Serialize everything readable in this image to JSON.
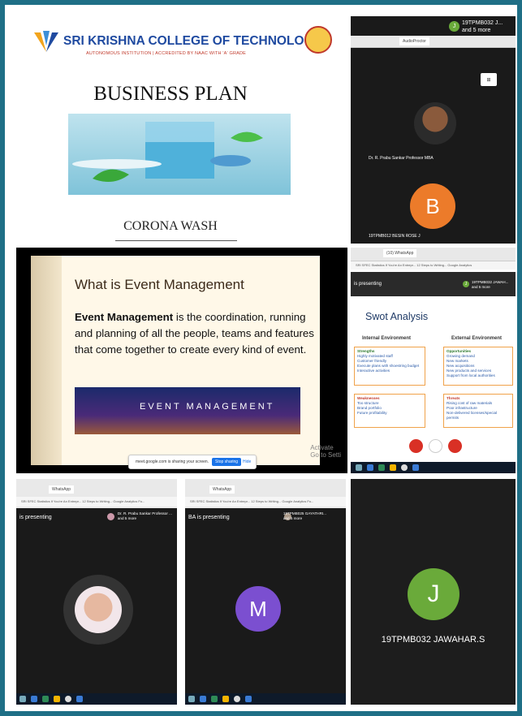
{
  "slide1": {
    "college": "SRI KRISHNA COLLEGE OF TECHNOLOGY",
    "college_sub": "AUTONOMOUS INSTITUTION | ACCREDITED BY NAAC WITH 'A' GRADE",
    "title": "BUSINESS PLAN",
    "subtitle": "CORONA WASH",
    "colors": {
      "brand_blue": "#1f4aa0",
      "brand_red": "#c0392b"
    }
  },
  "meet1": {
    "header_name": "19TPMB032 J...",
    "header_more": "and 5 more",
    "tab_label": "AudioProctor",
    "presenter_name": "Dr. R. Prabu Sankar Professor MBA",
    "avatar_letter": "B",
    "participant_name": "19TPMB012 BESIN ROSE J",
    "colors": {
      "avatar_b": "#ec7b2a",
      "avatar_j": "#6aaa3a"
    }
  },
  "slide2": {
    "title": "What is Event Management",
    "body_bold": "Event Management",
    "body_rest": " is the coordination, running and planning of all the people, teams and features that come together to create every kind of event.",
    "image_text": "EVENT MANAGEMENT",
    "share_text": "meet.google.com is sharing your screen.",
    "stop_sharing": "Stop sharing",
    "hide": "Hide",
    "activate": "Activate",
    "activate_sub": "Go to Setti"
  },
  "swot": {
    "tab_label": "(10) WhatsApp",
    "presenting": "is presenting",
    "header_name": "19TPMB032 JAWAH...",
    "header_more": "and 5 more",
    "title": "Swot Analysis",
    "internal": "Internal Environment",
    "external": "External Environment",
    "strengths": {
      "heading": "Strengths",
      "items": [
        "Highly motivated staff",
        "Customer friendly",
        "Execute plans with shoestring budget",
        "Interactive activities"
      ]
    },
    "opportunities": {
      "heading": "Opportunities",
      "items": [
        "Growing demand",
        "New markets",
        "New acquisitions",
        "New products and services",
        "Support from local authorities"
      ]
    },
    "weaknesses": {
      "heading": "Weaknesses",
      "items": [
        "Too structure",
        "Brand portfolio",
        "Future profitability"
      ]
    },
    "threats": {
      "heading": "Threats",
      "items": [
        "Rising cost of raw materials",
        "Poor infrastructure",
        "Non-delivered licenses/special permits"
      ]
    }
  },
  "bottom_left": {
    "tab_label": "WhatsApp",
    "presenting": "is presenting",
    "header_name": "Dr. R. Prabu Sankar Professor ...",
    "header_more": "and 5 more",
    "bookmarks": "SRI SFEC Statistics   If You're An Entrepr...   12 Steps to Writing...   Google Analytics Fo..."
  },
  "bottom_mid": {
    "tab_label": "WhatsApp",
    "presenting": "BA is presenting",
    "header_name": "19TPMB025 GAYATHRI...",
    "header_more": "and 5 more",
    "avatar_letter": "M",
    "bookmarks": "SRI SFEC Statistics   If You're An Entrepr...   12 Steps to Writing...   Google Analytics Fo...",
    "colors": {
      "avatar_m": "#7b4fd0"
    }
  },
  "bottom_right": {
    "avatar_letter": "J",
    "name": "19TPMB032 JAWAHAR.S",
    "colors": {
      "avatar_j": "#6aaa3a"
    }
  }
}
